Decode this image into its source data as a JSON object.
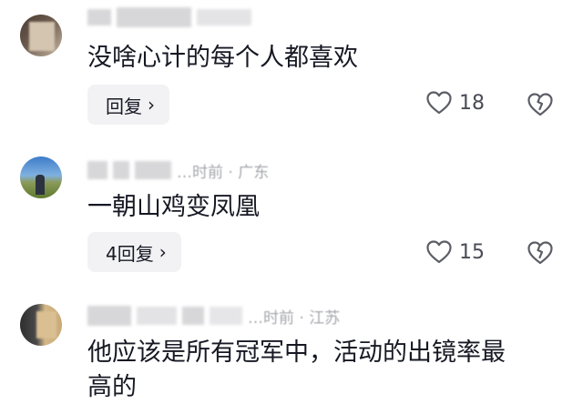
{
  "comments": [
    {
      "text": "没啥心计的每个人都喜欢",
      "meta_visible": "",
      "reply_label": "回复",
      "likes": "18",
      "colors": [
        "#5a4a3f",
        "#c9b8a3"
      ]
    },
    {
      "text": "一朝山鸡变凤凰",
      "meta_visible": "…时前 · 广东",
      "reply_label": "4回复",
      "likes": "15",
      "colors": [
        "#4f86c6",
        "#6a8a3a"
      ]
    },
    {
      "text": "他应该是所有冠军中，活动的出镜率最",
      "text_cut": "高的",
      "meta_visible": "…时前 · 江苏",
      "reply_label": "",
      "likes": "",
      "colors": [
        "#3b3b3b",
        "#d7b98c"
      ]
    }
  ]
}
